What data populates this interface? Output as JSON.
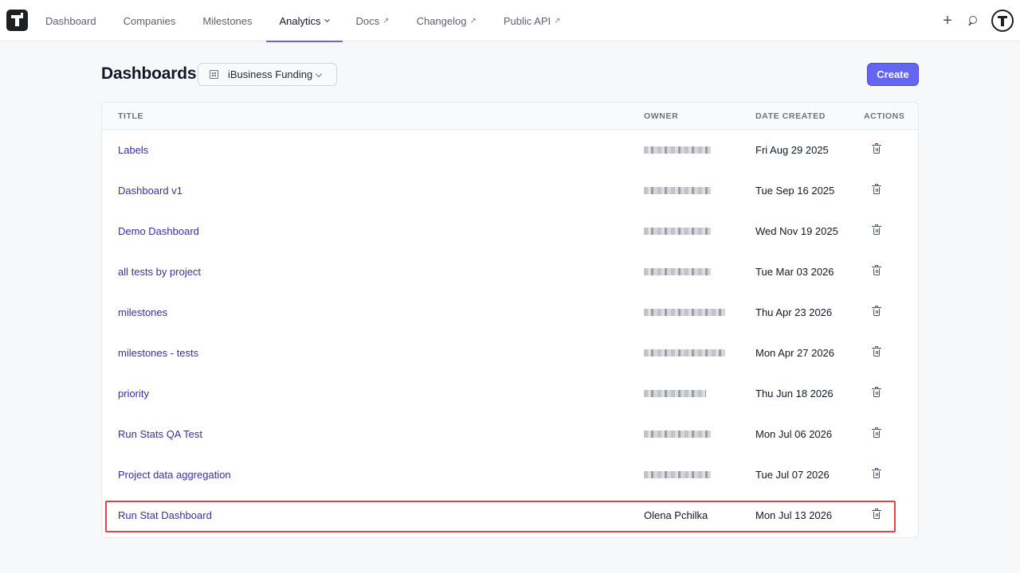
{
  "nav": {
    "items": [
      {
        "label": "Dashboard",
        "active": false
      },
      {
        "label": "Companies",
        "active": false
      },
      {
        "label": "Milestones",
        "active": false
      },
      {
        "label": "Analytics",
        "active": true
      },
      {
        "label": "Docs",
        "active": false
      },
      {
        "label": "Changelog",
        "active": false
      },
      {
        "label": "Public API",
        "active": false
      }
    ]
  },
  "header": {
    "title": "Dashboards",
    "company": "iBusiness Funding",
    "create_label": "Create"
  },
  "table": {
    "columns": {
      "title": "TITLE",
      "owner": "OWNER",
      "date": "DATE CREATED",
      "actions": "ACTIONS"
    },
    "rows": [
      {
        "title": "Labels",
        "owner": "",
        "date": "Fri Aug 29 2025"
      },
      {
        "title": "Dashboard v1",
        "owner": "",
        "date": "Tue Sep 16 2025"
      },
      {
        "title": "Demo Dashboard",
        "owner": "",
        "date": "Wed Nov 19 2025"
      },
      {
        "title": "all tests by project",
        "owner": "",
        "date": "Tue Mar 03 2026"
      },
      {
        "title": "milestones",
        "owner": "",
        "date": "Thu Apr 23 2026"
      },
      {
        "title": "milestones - tests",
        "owner": "",
        "date": "Mon Apr 27 2026"
      },
      {
        "title": "priority",
        "owner": "",
        "date": "Thu Jun 18 2026"
      },
      {
        "title": "Run Stats QA Test",
        "owner": "",
        "date": "Mon Jul 06 2026"
      },
      {
        "title": "Project data aggregation",
        "owner": "",
        "date": "Tue Jul 07 2026"
      },
      {
        "title": "Run Stat Dashboard",
        "owner": "Olena Pchilka",
        "date": "Mon Jul 13 2026"
      }
    ]
  },
  "colors": {
    "accent": "#6366f1",
    "link": "#3730a3",
    "highlight": "#e5414c"
  },
  "icons": [
    "logo-icon",
    "chevron-down-icon",
    "external-link-icon",
    "plus-icon",
    "support-icon",
    "avatar",
    "building-icon",
    "trash-icon"
  ]
}
